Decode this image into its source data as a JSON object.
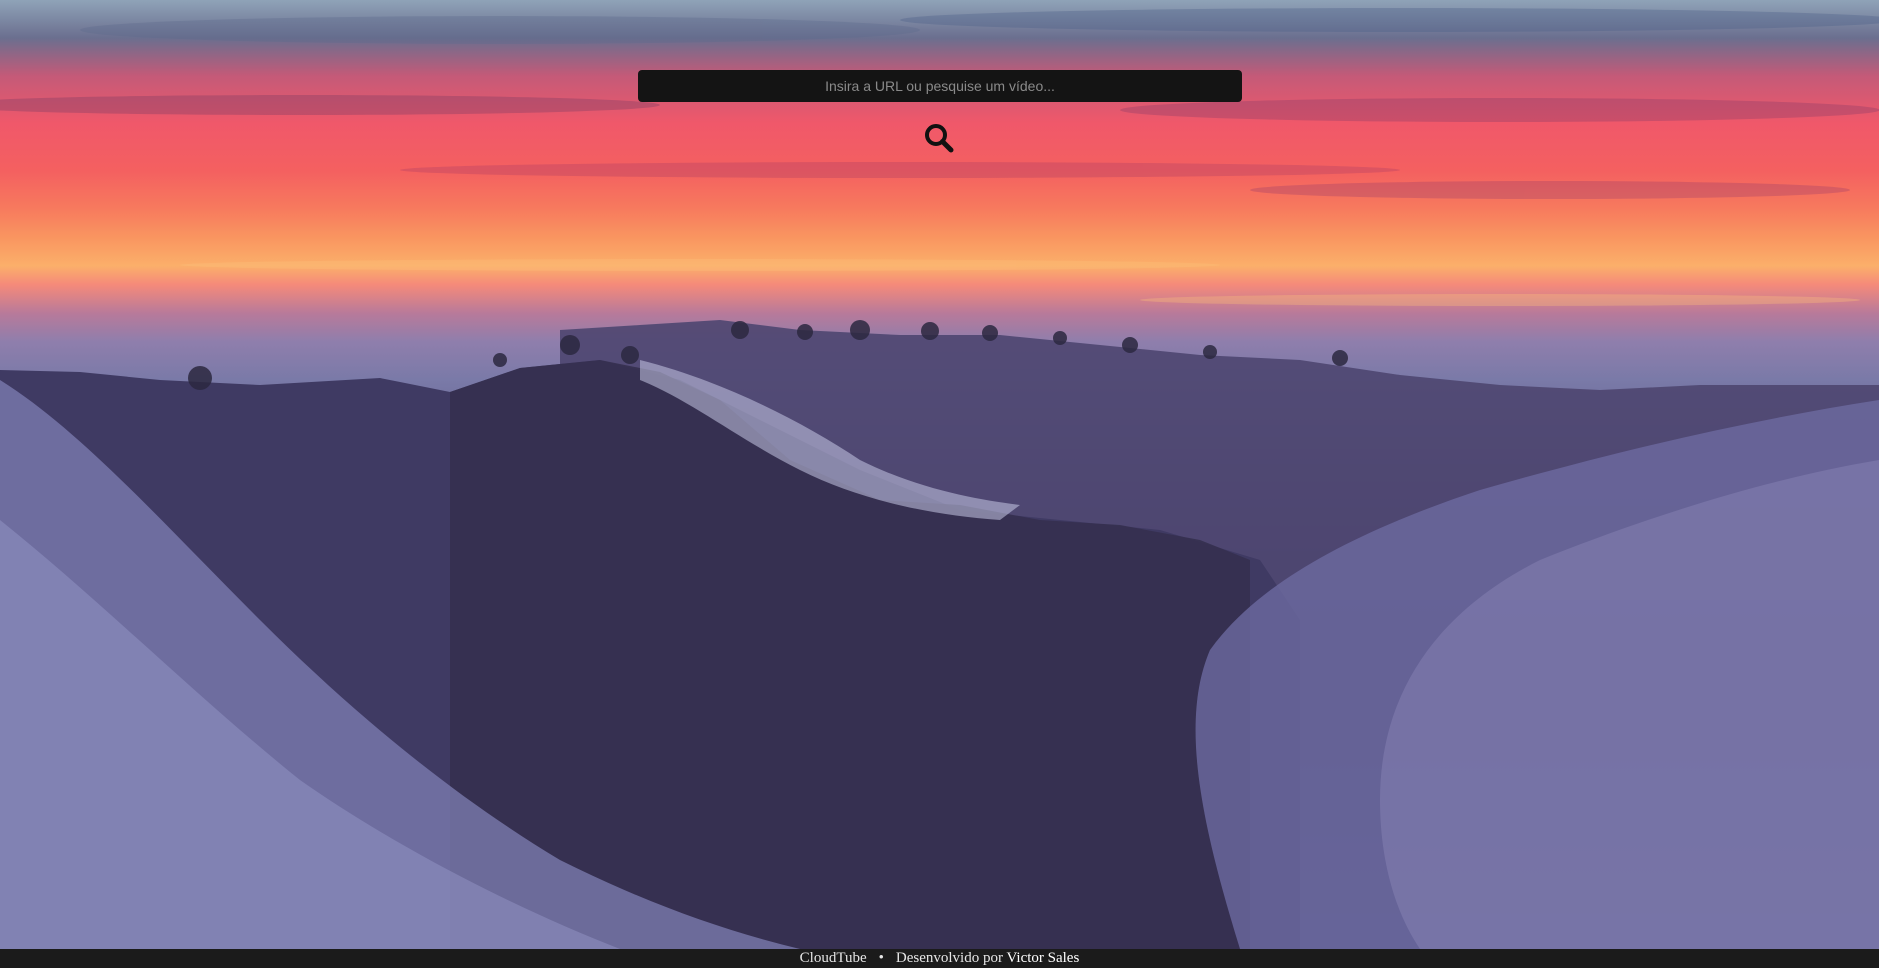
{
  "search": {
    "placeholder": "Insira a URL ou pesquise um vídeo...",
    "value": "",
    "button_icon": "search-icon"
  },
  "footer": {
    "brand": "CloudTube",
    "separator": "•",
    "credit_prefix": "Desenvolvido por",
    "author": "Victor Sales"
  },
  "colors": {
    "search_bg": "#141414",
    "footer_bg": "#1b1b1b",
    "icon": "#111111"
  }
}
